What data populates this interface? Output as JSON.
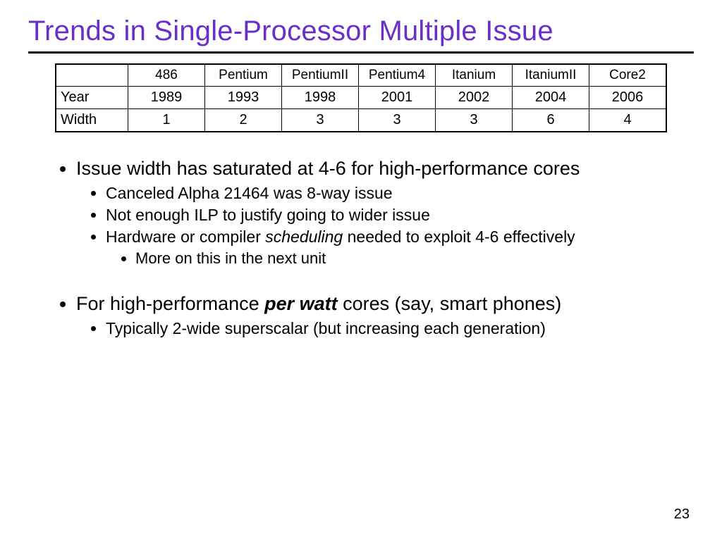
{
  "title": "Trends in Single-Processor Multiple Issue",
  "table": {
    "cols": [
      "486",
      "Pentium",
      "PentiumII",
      "Pentium4",
      "Itanium",
      "ItaniumII",
      "Core2"
    ],
    "rows": [
      {
        "label": "Year",
        "cells": [
          "1989",
          "1993",
          "1998",
          "2001",
          "2002",
          "2004",
          "2006"
        ]
      },
      {
        "label": "Width",
        "cells": [
          "1",
          "2",
          "3",
          "3",
          "3",
          "6",
          "4"
        ]
      }
    ]
  },
  "b1": {
    "text": "Issue width has saturated at 4-6 for high-performance cores",
    "s1": "Canceled Alpha 21464 was 8-way issue",
    "s2": "Not enough ILP to justify going to wider issue",
    "s3a": "Hardware or compiler ",
    "s3b": "scheduling",
    "s3c": " needed to exploit 4-6 effectively",
    "s3s1": "More on this in the next unit"
  },
  "b2": {
    "a": "For high-performance ",
    "b": "per watt",
    "c": " cores (say, smart phones)",
    "s1": "Typically 2-wide superscalar (but increasing each generation)"
  },
  "pagenum": "23",
  "chart_data": {
    "type": "table",
    "title": "Trends in Single-Processor Multiple Issue",
    "columns": [
      "486",
      "Pentium",
      "PentiumII",
      "Pentium4",
      "Itanium",
      "ItaniumII",
      "Core2"
    ],
    "rows": {
      "Year": [
        1989,
        1993,
        1998,
        2001,
        2002,
        2004,
        2006
      ],
      "Width": [
        1,
        2,
        3,
        3,
        3,
        6,
        4
      ]
    }
  }
}
